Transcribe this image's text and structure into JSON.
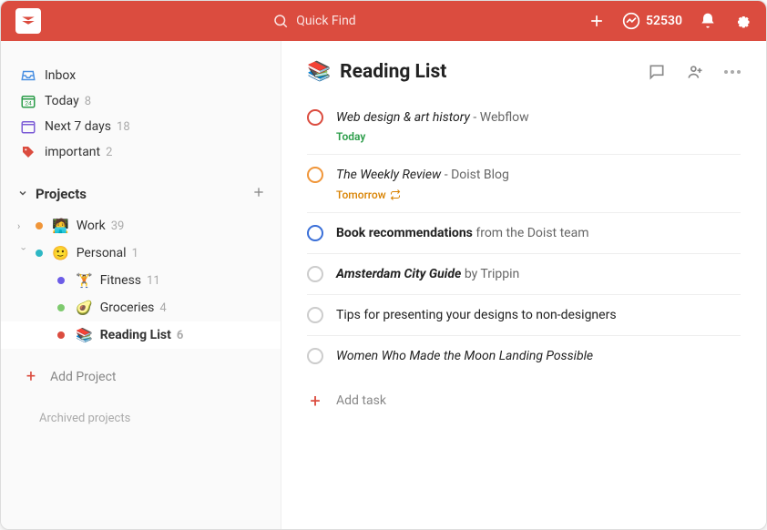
{
  "topbar": {
    "search_placeholder": "Quick Find",
    "karma": "52530"
  },
  "sidebar": {
    "inbox": "Inbox",
    "today": "Today",
    "today_count": "8",
    "next7": "Next 7 days",
    "next7_count": "18",
    "important": "important",
    "important_count": "2",
    "projects_header": "Projects",
    "work": {
      "label": "Work",
      "count": "39",
      "emoji": "🧑‍💻"
    },
    "personal": {
      "label": "Personal",
      "count": "1",
      "emoji": "🙂"
    },
    "fitness": {
      "label": "Fitness",
      "count": "11",
      "emoji": "🏋️"
    },
    "groceries": {
      "label": "Groceries",
      "count": "4",
      "emoji": "🥑"
    },
    "reading": {
      "label": "Reading List",
      "count": "6",
      "emoji": "📚"
    },
    "add_project": "Add Project",
    "archived": "Archived projects"
  },
  "main": {
    "title_emoji": "📚",
    "title": "Reading List",
    "add_task": "Add task",
    "tasks": [
      {
        "title": "Web design & art history",
        "suffix": " - Webflow",
        "style": "italic",
        "due": "Today",
        "due_class": "today",
        "circle_color": "#db4c3f",
        "repeat": false
      },
      {
        "title": "The Weekly Review",
        "suffix": " - Doist Blog",
        "style": "italic",
        "due": "Tomorrow",
        "due_class": "tomorrow",
        "circle_color": "#f09538",
        "repeat": true
      },
      {
        "title": "Book recommendations",
        "suffix": " from the Doist team",
        "style": "bold",
        "due": "",
        "due_class": "",
        "circle_color": "#3a6fd8",
        "repeat": false
      },
      {
        "title": "Amsterdam City Guide",
        "suffix": " by Trippin",
        "style": "bolditalic",
        "due": "",
        "due_class": "",
        "circle_color": "gray",
        "repeat": false
      },
      {
        "title": "Tips for presenting your designs to non-designers",
        "suffix": "",
        "style": "normal",
        "due": "",
        "due_class": "",
        "circle_color": "gray",
        "repeat": false
      },
      {
        "title": "Women Who Made the Moon Landing Possible",
        "suffix": "",
        "style": "italic",
        "due": "",
        "due_class": "",
        "circle_color": "gray",
        "repeat": false
      }
    ]
  }
}
